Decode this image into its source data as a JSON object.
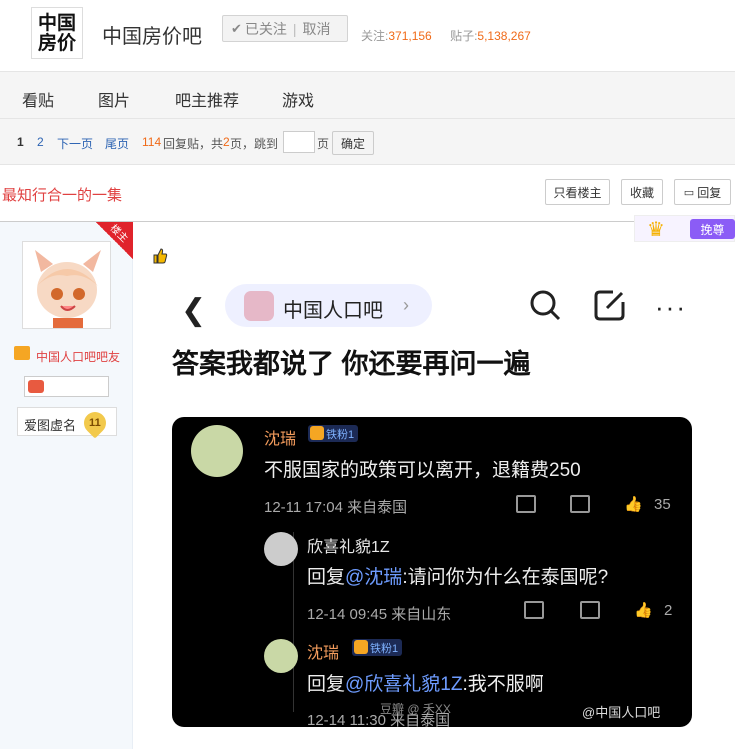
{
  "header": {
    "logo_text": "中国房价",
    "bar_name": "中国房价吧",
    "follow_label": "已关注",
    "unfollow_label": "取消",
    "stats": {
      "follow_label": "关注:",
      "follow_count": "371,156",
      "posts_label": "贴子:",
      "posts_count": "5,138,267"
    }
  },
  "nav": {
    "tabs": [
      "看贴",
      "图片",
      "吧主推荐",
      "游戏"
    ]
  },
  "pager": {
    "page1": "1",
    "page2": "2",
    "next": "下一页",
    "last": "尾页",
    "reply_count": "114",
    "reply_text": "回复贴，共",
    "total_pages": "2",
    "page_unit": "页，跳到",
    "page_suffix": "页",
    "confirm": "确定"
  },
  "post": {
    "title": "最知行合一的一集",
    "only_op": "只看楼主",
    "favorite": "收藏",
    "reply": "回复",
    "op_badge": "楼主",
    "huanzun": "挽尊"
  },
  "author": {
    "friend_title": "中国人口吧吧友",
    "badge_name": "爱图虚名",
    "level": "11"
  },
  "screenshot": {
    "bar_name": "中国人口吧",
    "headline": "答案我都说了 你还要再问一遍",
    "comment1": {
      "user": "沈瑞",
      "fan_badge": "铁粉1",
      "text": "不服国家的政策可以离开，退籍费250",
      "meta": "12-11 17:04  来自泰国",
      "likes": "35"
    },
    "reply1": {
      "user": "欣喜礼貌1Z",
      "prefix": "回复",
      "at": "@沈瑞",
      "text": ":请问你为什么在泰国呢?",
      "meta": "12-14 09:45  来自山东",
      "likes": "2"
    },
    "reply2": {
      "user": "沈瑞",
      "fan_badge": "铁粉1",
      "prefix": "回复",
      "at": "@欣喜礼貌1Z",
      "text": ":我不服啊",
      "meta": "12-14 11:30  来自泰国"
    },
    "watermark": "@中国人口吧",
    "watermark2": "豆瓣 @ 禾XX"
  },
  "colors": {
    "accent_orange": "#f06a18",
    "title_red": "#e04141",
    "link_blue": "#2d64b3"
  }
}
